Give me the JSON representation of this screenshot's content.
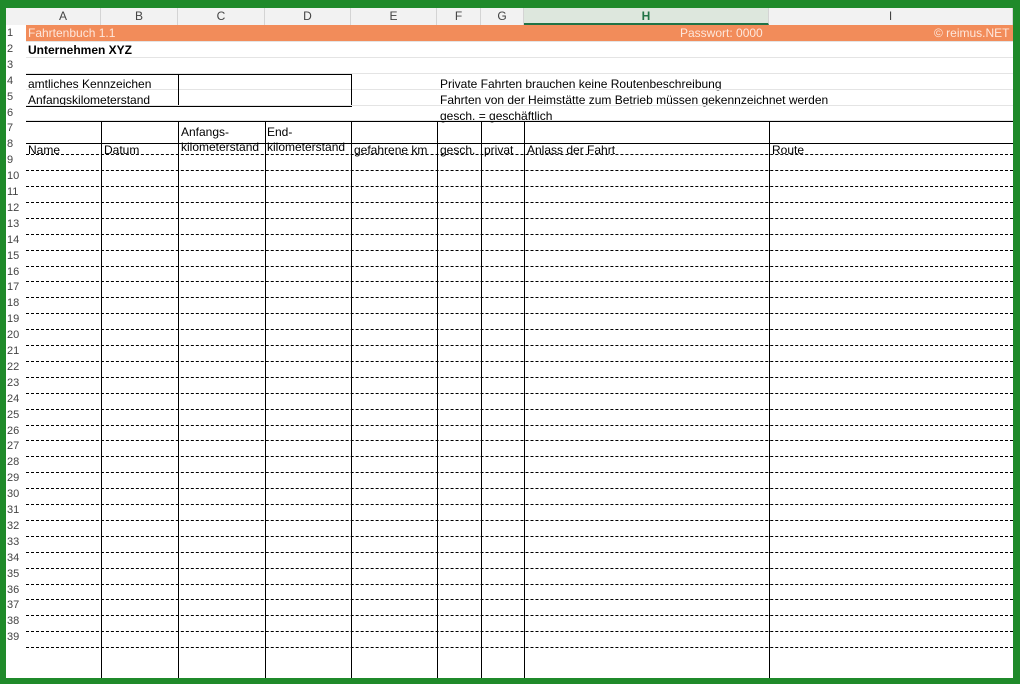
{
  "columns": [
    "A",
    "B",
    "C",
    "D",
    "E",
    "F",
    "G",
    "H",
    "I"
  ],
  "selected_column": "H",
  "header_band": {
    "title": "Fahrtenbuch 1.1",
    "password": "Passwort: 0000",
    "copyright": "© reimus.NET"
  },
  "company": "Unternehmen XYZ",
  "fields": {
    "license_plate_label": "amtliches Kennzeichen",
    "start_km_label": "Anfangskilometerstand"
  },
  "notes": [
    "Private Fahrten brauchen keine Routenbeschreibung",
    "Fahrten von der Heimstätte zum Betrieb müssen gekennzeichnet werden",
    "gesch. = geschäftlich"
  ],
  "table_headers": {
    "name": "Name",
    "datum": "Datum",
    "anfangs_1": "Anfangs-",
    "anfangs_2": "kilometerstand",
    "end_1": "End-",
    "end_2": "kilometerstand",
    "gefahrene": "gefahrene km",
    "gesch": "gesch.",
    "privat": "privat",
    "anlass": "Anlass der Fahrt",
    "route": "Route"
  },
  "row_numbers": [
    "1",
    "2",
    "3",
    "4",
    "5",
    "6",
    "7",
    "8",
    "9",
    "10",
    "11",
    "12",
    "13",
    "14",
    "15",
    "16",
    "17",
    "18",
    "19",
    "20",
    "21",
    "22",
    "23",
    "24",
    "25",
    "26",
    "27",
    "28",
    "29",
    "30",
    "31",
    "32",
    "33",
    "34",
    "35",
    "36",
    "37",
    "38",
    "39"
  ]
}
